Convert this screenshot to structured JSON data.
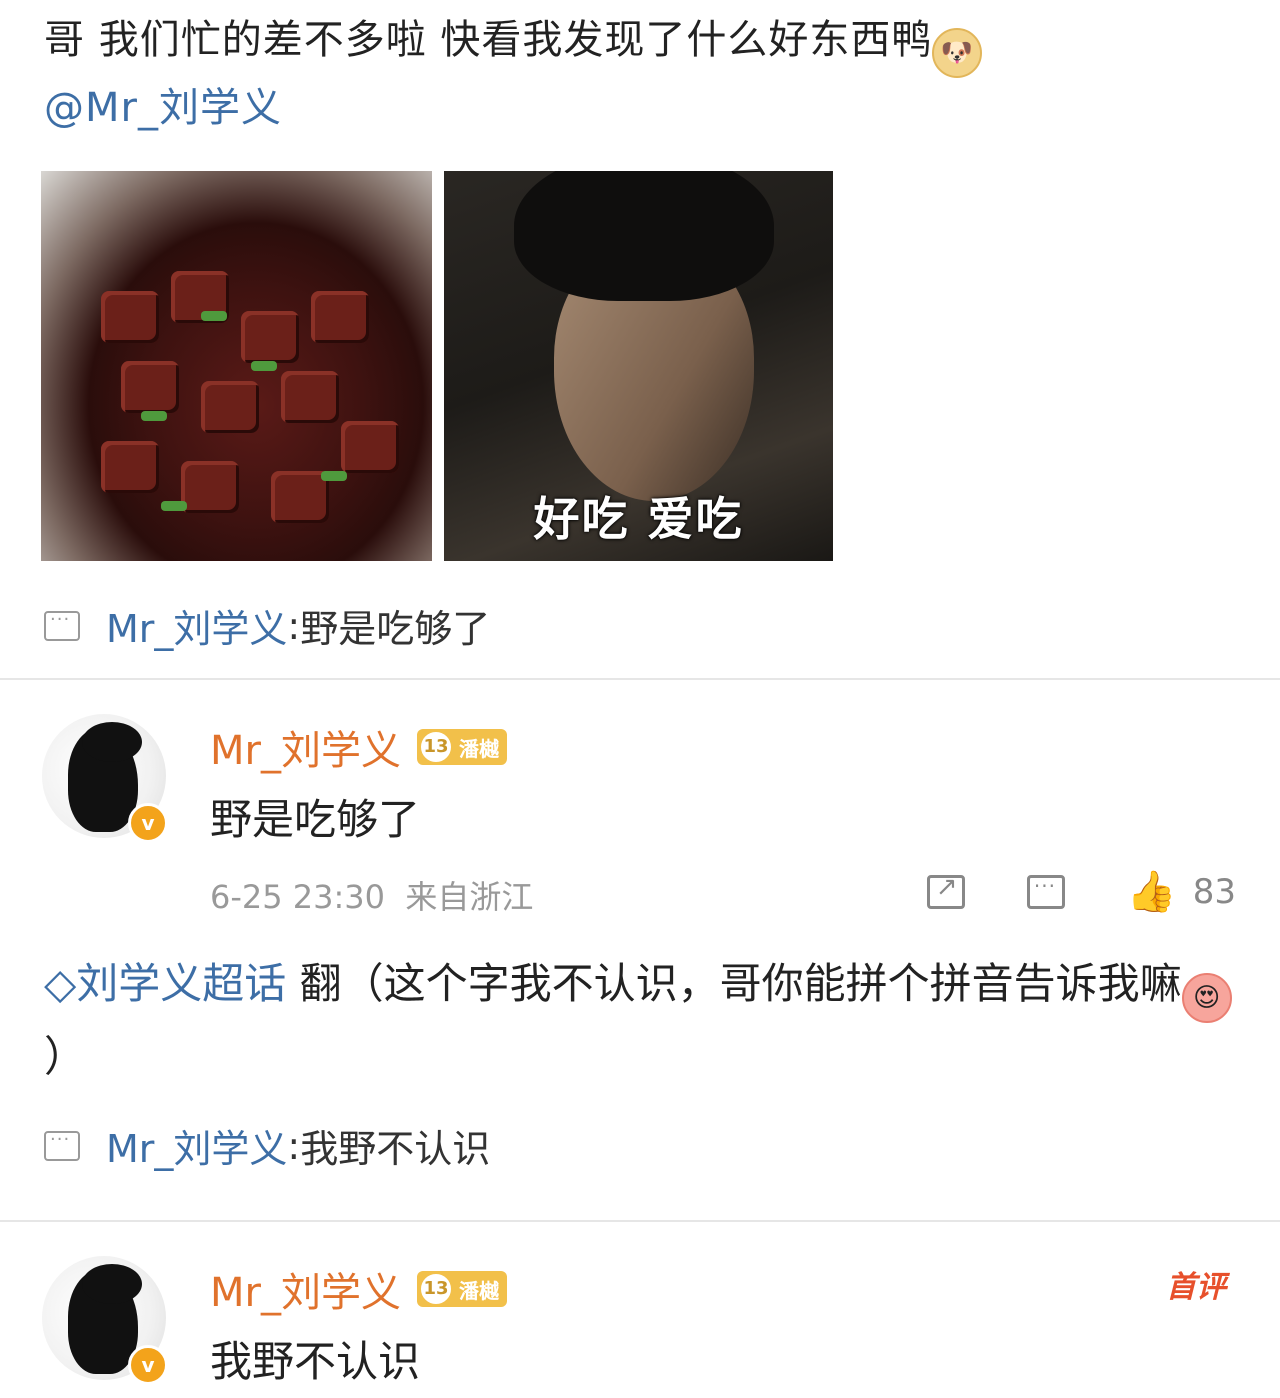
{
  "post": {
    "text": "哥 我们忙的差不多啦 快看我发现了什么好东西鸭",
    "mention": "@Mr_刘学义",
    "image2_caption": "好吃 爱吃",
    "reply_author": "Mr_刘学义",
    "reply_sep": ": ",
    "reply_text": "野是吃够了"
  },
  "comment1": {
    "author": "Mr_刘学义",
    "level": "13",
    "level_tag": "潘樾",
    "text": "野是吃够了",
    "time": "6-25 23:30",
    "location": "来自浙江",
    "likes": "83"
  },
  "post2": {
    "topic": "◇刘学义超话",
    "text_before_emoji": " 翻（这个字我不认识，哥你能拼个拼音告诉我嘛",
    "text_after_emoji": "）",
    "reply_author": "Mr_刘学义",
    "reply_sep": ": ",
    "reply_text": "我野不认识"
  },
  "comment2": {
    "author": "Mr_刘学义",
    "level": "13",
    "level_tag": "潘樾",
    "text": "我野不认识",
    "first_badge": "首评"
  },
  "icons": [
    "doge-emoji",
    "love-emoji",
    "comment-icon",
    "share-icon",
    "like-icon",
    "verified-badge"
  ],
  "colors": {
    "link": "#3d6ea6",
    "author": "#e0722c",
    "level": "#f2c04a",
    "verified": "#f3a31b",
    "first": "#e7502b"
  }
}
